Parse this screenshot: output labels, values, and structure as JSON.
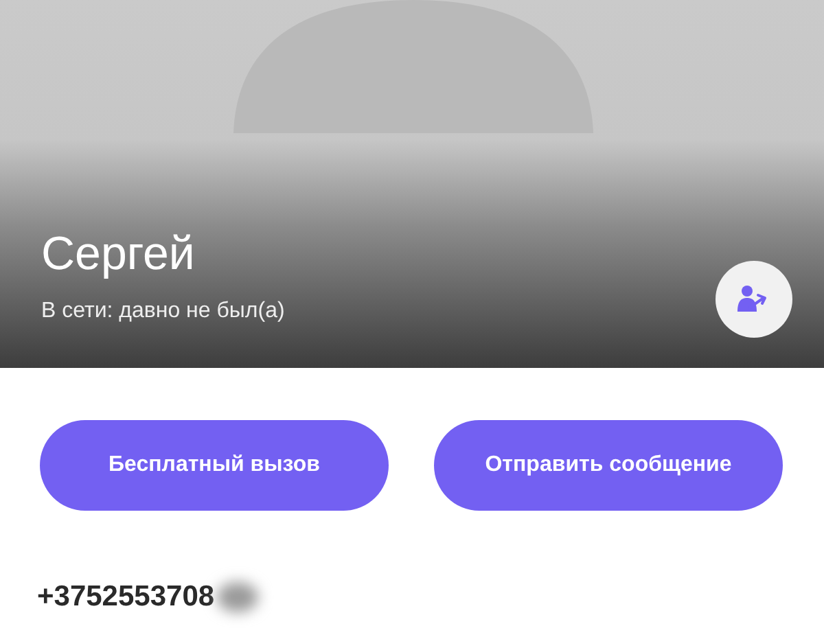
{
  "contact": {
    "name": "Сергей",
    "status": "В сети: давно не был(а)"
  },
  "buttons": [
    {
      "label": "Бесплатный вызов"
    },
    {
      "label": "Отправить сообщение"
    }
  ],
  "phone": {
    "number": "+3752553708",
    "redacted": true
  }
}
